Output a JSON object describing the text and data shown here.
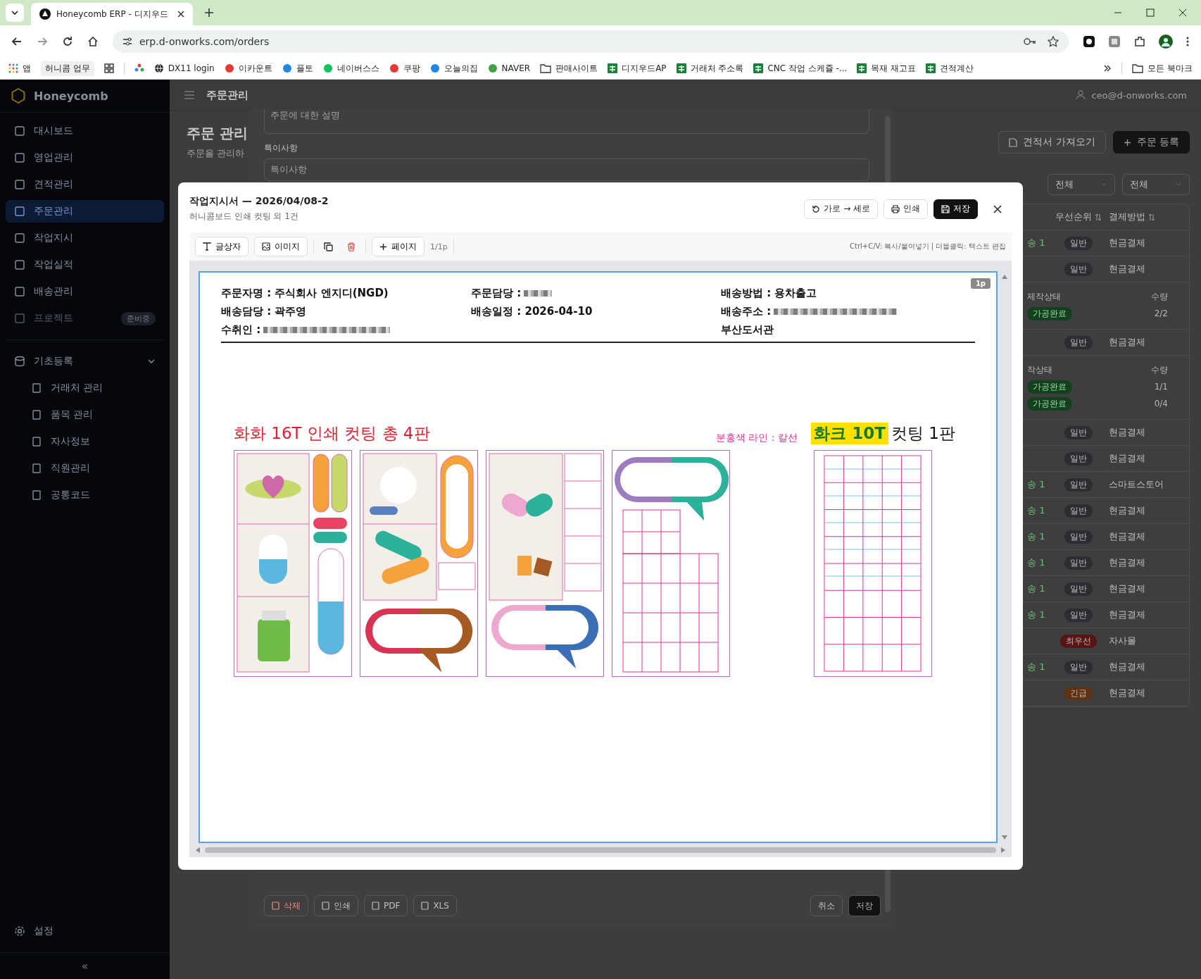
{
  "browser": {
    "tab_title": "Honeycomb ERP - 디지우드",
    "url": "erp.d-onworks.com/orders",
    "bookmarks": [
      {
        "label": "앱",
        "kind": "apps"
      },
      {
        "label": "허니콤 업무",
        "kind": "chip"
      },
      {
        "label": "DX11 login",
        "kind": "globe"
      },
      {
        "label": "이카운트",
        "kind": "site"
      },
      {
        "label": "플토",
        "kind": "site"
      },
      {
        "label": "네이버스스",
        "kind": "site"
      },
      {
        "label": "쿠팡",
        "kind": "site"
      },
      {
        "label": "오늘의집",
        "kind": "site"
      },
      {
        "label": "NAVER",
        "kind": "site"
      },
      {
        "label": "판매사이트",
        "kind": "folder"
      },
      {
        "label": "디지우드AP",
        "kind": "sheet"
      },
      {
        "label": "거래처 주소록",
        "kind": "sheet"
      },
      {
        "label": "CNC 작업 스케쥴 -...",
        "kind": "sheet"
      },
      {
        "label": "목재 재고표",
        "kind": "sheet"
      },
      {
        "label": "견적계산",
        "kind": "sheet"
      }
    ],
    "all_bookmarks": "모든 북마크"
  },
  "sidebar": {
    "brand": "Honeycomb",
    "items": [
      {
        "label": "대시보드",
        "selected": false,
        "disabled": false
      },
      {
        "label": "영업관리",
        "selected": false,
        "disabled": false
      },
      {
        "label": "견적관리",
        "selected": false,
        "disabled": false
      },
      {
        "label": "주문관리",
        "selected": true,
        "disabled": false
      },
      {
        "label": "작업지시",
        "selected": false,
        "disabled": false
      },
      {
        "label": "작업실적",
        "selected": false,
        "disabled": false
      },
      {
        "label": "배송관리",
        "selected": false,
        "disabled": false
      },
      {
        "label": "프로젝트",
        "selected": false,
        "disabled": true,
        "badge": "준비중"
      }
    ],
    "group": {
      "label": "기초등록",
      "expanded": true,
      "children": [
        {
          "label": "거래처 관리"
        },
        {
          "label": "품목 관리"
        },
        {
          "label": "자사정보"
        },
        {
          "label": "직원관리"
        },
        {
          "label": "공통코드"
        }
      ]
    },
    "settings": "설정",
    "collapse": "«"
  },
  "topbar": {
    "breadcrumb": "주문관리",
    "user": "ceo@d-onworks.com"
  },
  "page": {
    "title": "주문 관리",
    "subtitle": "주문을 관리하",
    "buttons": [
      {
        "label": "견적서 가져오기",
        "primary": false
      },
      {
        "label": "주문 등록",
        "primary": true
      }
    ],
    "filters": [
      "전체",
      "전체"
    ],
    "table": {
      "columns": [
        "우선순위",
        "결제방법"
      ],
      "rows": [
        {
          "kind": "order",
          "shipping": "송 1",
          "priority": "일반",
          "color": "#2b2d33",
          "payment": "현금결제"
        },
        {
          "kind": "order",
          "priority": "일반",
          "color": "#2b2d33",
          "payment": "현금결제"
        },
        {
          "kind": "detail",
          "headers": [
            "제작상태",
            "수량"
          ],
          "items": [
            {
              "status": "가공완료",
              "qty": "2/2"
            }
          ]
        },
        {
          "kind": "order",
          "priority": "일반",
          "color": "#2b2d33",
          "payment": "현금결제"
        },
        {
          "kind": "detail",
          "headers": [
            "작상태",
            "수량"
          ],
          "items": [
            {
              "status": "가공완료",
              "qty": "1/1"
            },
            {
              "status": "가공완료",
              "qty": "0/4"
            }
          ]
        },
        {
          "kind": "order",
          "priority": "일반",
          "color": "#2b2d33",
          "payment": "현금결제"
        },
        {
          "kind": "order",
          "priority": "일반",
          "color": "#2b2d33",
          "payment": "현금결제"
        },
        {
          "kind": "order",
          "shipping": "송 1",
          "priority": "일반",
          "color": "#2b2d33",
          "payment": "스마트스토어"
        },
        {
          "kind": "order",
          "shipping": "송 1",
          "priority": "일반",
          "color": "#2b2d33",
          "payment": "현금결제"
        },
        {
          "kind": "order",
          "shipping": "송 1",
          "priority": "일반",
          "color": "#2b2d33",
          "payment": "현금결제"
        },
        {
          "kind": "order",
          "shipping": "송 1",
          "priority": "일반",
          "color": "#2b2d33",
          "payment": "현금결제"
        },
        {
          "kind": "order",
          "shipping": "송 1",
          "priority": "일반",
          "color": "#2b2d33",
          "payment": "현금결제"
        },
        {
          "kind": "order",
          "shipping": "송 1",
          "priority": "일반",
          "color": "#2b2d33",
          "payment": "현금결제"
        },
        {
          "kind": "order",
          "priority": "최우선",
          "color": "#5a1414",
          "payment": "자사몰"
        },
        {
          "kind": "order",
          "shipping": "송 1",
          "priority": "일반",
          "color": "#2b2d33",
          "payment": "현금결제"
        },
        {
          "kind": "order",
          "priority": "긴급",
          "color": "#5e3210",
          "payment": "현금결제"
        }
      ]
    }
  },
  "form": {
    "description_placeholder": "주문에 대한 설명",
    "notes_label": "특이사항",
    "notes_placeholder": "특이사항",
    "footer_left": [
      {
        "label": "삭제",
        "kind": "delete"
      },
      {
        "label": "인쇄",
        "kind": "print"
      },
      {
        "label": "PDF",
        "kind": "file"
      },
      {
        "label": "XLS",
        "kind": "file"
      }
    ],
    "footer_right": [
      {
        "label": "취소",
        "primary": false
      },
      {
        "label": "저장",
        "primary": true
      }
    ]
  },
  "modal": {
    "title": "작업지시서 — 2026/04/08-2",
    "subtitle": "허니콤보드 인쇄 컷팅 외 1건",
    "actions": [
      {
        "label": "가로 → 세로",
        "kind": "rotate"
      },
      {
        "label": "인쇄",
        "kind": "print"
      },
      {
        "label": "저장",
        "kind": "save"
      }
    ],
    "toolbar": {
      "text_box": "글상자",
      "image": "이미지",
      "page": "페이지",
      "page_count": "1/1p",
      "hint": "Ctrl+C/V: 복사/붙여넣기 | 더블클릭: 텍스트 편집"
    },
    "sheet": {
      "page_badge": "1p",
      "field_columns": [
        [
          {
            "label": "주문자명 : 주식회사 엔지디(NGD)"
          },
          {
            "label": "배송담당 : 곽주영"
          },
          {
            "label": "수취인 : ",
            "redacted": true
          }
        ],
        [
          {
            "label": "주문담당 : ",
            "redacted": true
          },
          {
            "label": "배송일정 : 2026-04-10"
          }
        ],
        [
          {
            "label": "배송방법 : 용차출고"
          },
          {
            "label": "배송주소 : ",
            "redacted": true
          },
          {
            "label": "부산도서관"
          }
        ]
      ],
      "left_heading": "화화 16T 인쇄 컷팅 총 4판",
      "annotation": "분홍색 라인 : 칼선",
      "right_heading_highlight": "화크 10T",
      "right_heading_rest": "컷팅 1판"
    }
  }
}
